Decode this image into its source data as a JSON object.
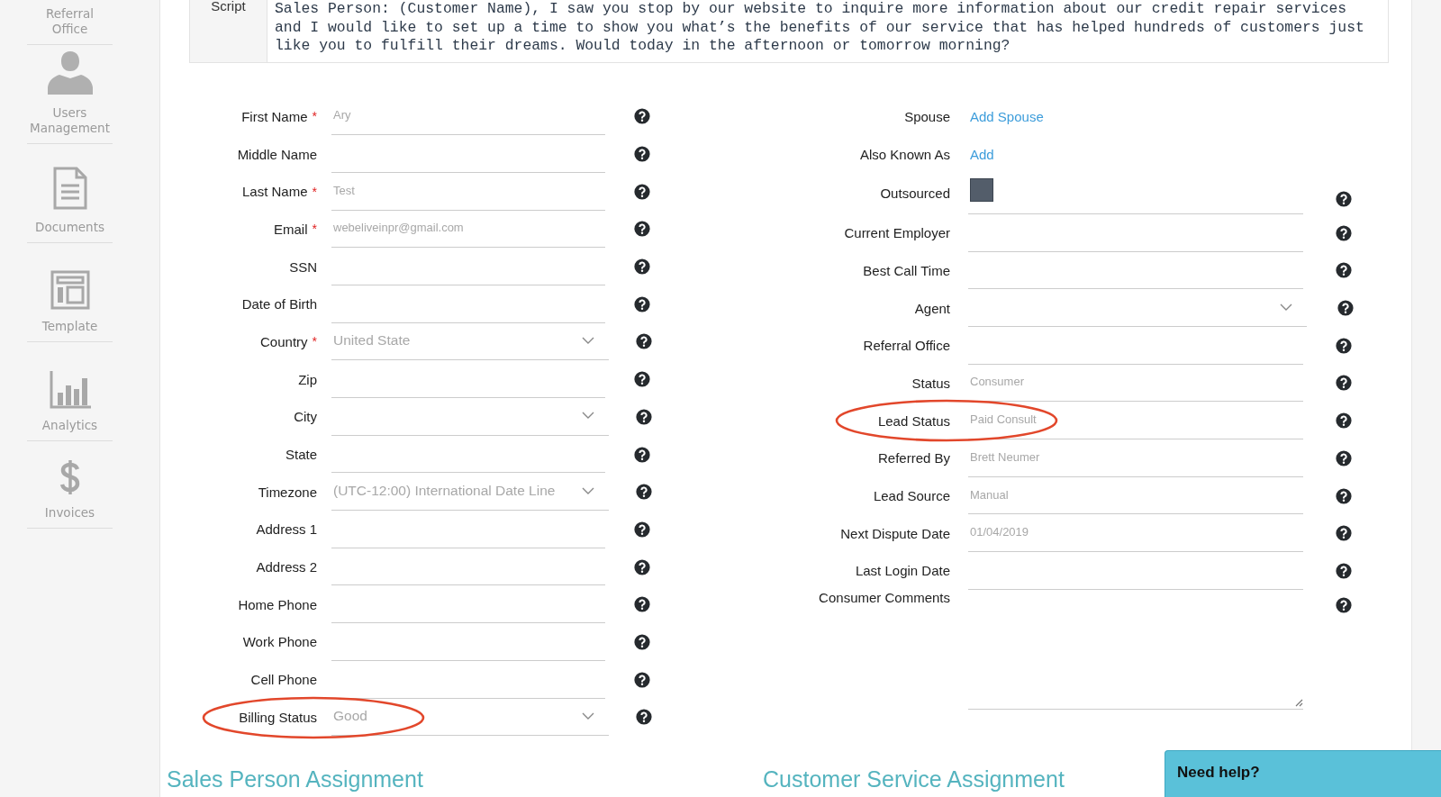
{
  "sidebar": {
    "items": [
      {
        "label": "Referral Office"
      },
      {
        "label": "Users Management"
      },
      {
        "label": "Documents"
      },
      {
        "label": "Template"
      },
      {
        "label": "Analytics"
      },
      {
        "label": "Invoices"
      }
    ]
  },
  "script": {
    "label": "Script",
    "text": "Sales Person: (Customer Name), I saw you stop by our website to inquire more information about our credit repair services and I would like to set up a time to show you what’s the benefits of our service that has helped hundreds of customers just like you to fulfill their dreams. Would today in the afternoon or tomorrow morning?"
  },
  "left_fields": [
    {
      "label": "First Name",
      "required_mark": "*",
      "kind": "text",
      "value": "Ary",
      "help": true,
      "highlighted": false
    },
    {
      "label": "Middle Name",
      "kind": "text",
      "help": true,
      "highlighted": false
    },
    {
      "label": "Last Name",
      "required_mark": "*",
      "kind": "text",
      "value": "Test",
      "help": true,
      "highlighted": false
    },
    {
      "label": "Email",
      "required_mark": "*",
      "kind": "text",
      "value": "webeliveinpr@gmail.com",
      "help": true,
      "highlighted": false
    },
    {
      "label": "SSN",
      "kind": "text",
      "help": true,
      "highlighted": false
    },
    {
      "label": "Date of Birth",
      "kind": "text",
      "help": true,
      "highlighted": false
    },
    {
      "label": "Country",
      "required_mark": "*",
      "kind": "select",
      "value": "United State",
      "help": true,
      "highlighted": false
    },
    {
      "label": "Zip",
      "kind": "text",
      "help": true,
      "highlighted": false
    },
    {
      "label": "City",
      "kind": "select",
      "help": true,
      "highlighted": false
    },
    {
      "label": "State",
      "kind": "text",
      "help": true,
      "highlighted": false
    },
    {
      "label": "Timezone",
      "kind": "select",
      "value": "(UTC-12:00) International Date Line",
      "help": true,
      "highlighted": false
    },
    {
      "label": "Address 1",
      "kind": "text",
      "help": true,
      "highlighted": false
    },
    {
      "label": "Address 2",
      "kind": "text",
      "help": true,
      "highlighted": false
    },
    {
      "label": "Home Phone",
      "kind": "text",
      "help": true,
      "highlighted": false
    },
    {
      "label": "Work Phone",
      "kind": "text",
      "help": true,
      "highlighted": false
    },
    {
      "label": "Cell Phone",
      "kind": "text",
      "help": true,
      "highlighted": false
    },
    {
      "label": "Billing Status",
      "kind": "select",
      "value": "Good",
      "help": true,
      "highlighted": true
    }
  ],
  "right_fields": [
    {
      "label": "Spouse",
      "kind": "link",
      "value": "Add Spouse",
      "help": false,
      "highlighted": false
    },
    {
      "label": "Also Known As",
      "kind": "link",
      "value": "Add",
      "help": false,
      "highlighted": false
    },
    {
      "label": "Outsourced",
      "kind": "checkbox",
      "checked": false,
      "help": true,
      "highlighted": false
    },
    {
      "label": "Current Employer",
      "kind": "text",
      "help": true,
      "highlighted": false
    },
    {
      "label": "Best Call Time",
      "kind": "text",
      "help": true,
      "highlighted": false
    },
    {
      "label": "Agent",
      "kind": "select",
      "help": true,
      "highlighted": false
    },
    {
      "label": "Referral Office",
      "kind": "text",
      "help": true,
      "highlighted": false
    },
    {
      "label": "Status",
      "kind": "text",
      "value": "Consumer",
      "help": true,
      "highlighted": false
    },
    {
      "label": "Lead Status",
      "kind": "text",
      "value": "Paid Consult",
      "help": true,
      "highlighted": true
    },
    {
      "label": "Referred By",
      "kind": "text",
      "value": "Brett Neumer",
      "help": true,
      "highlighted": false
    },
    {
      "label": "Lead Source",
      "kind": "text",
      "value": "Manual",
      "help": true,
      "highlighted": false
    },
    {
      "label": "Next Dispute Date",
      "kind": "text",
      "value": "01/04/2019",
      "help": true,
      "highlighted": false
    },
    {
      "label": "Last Login Date",
      "kind": "text",
      "help": true,
      "highlighted": false
    },
    {
      "label": "Consumer Comments",
      "kind": "textarea",
      "help": true,
      "highlighted": false
    }
  ],
  "sections": [
    {
      "title": "Sales Person Assignment"
    },
    {
      "title": "Customer Service Assignment"
    }
  ],
  "help_widget": {
    "label": "Need help?"
  }
}
